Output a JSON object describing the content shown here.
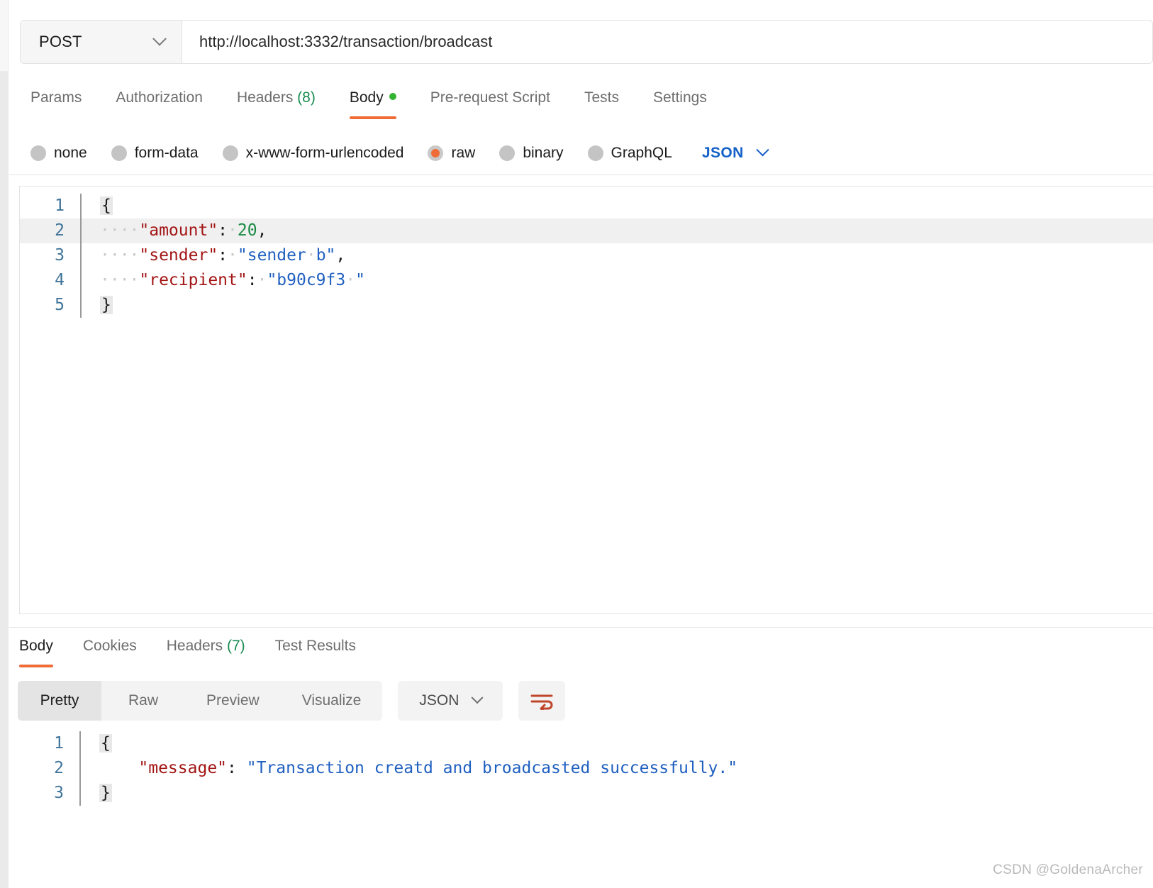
{
  "request": {
    "method": "POST",
    "method_caret": "chevron-down",
    "url": "http://localhost:3332/transaction/broadcast",
    "tabs": [
      {
        "label": "Params",
        "count": "",
        "active": false,
        "dot": false
      },
      {
        "label": "Authorization",
        "count": "",
        "active": false,
        "dot": false
      },
      {
        "label": "Headers",
        "count": "(8)",
        "active": false,
        "dot": false
      },
      {
        "label": "Body",
        "count": "",
        "active": true,
        "dot": true
      },
      {
        "label": "Pre-request Script",
        "count": "",
        "active": false,
        "dot": false
      },
      {
        "label": "Tests",
        "count": "",
        "active": false,
        "dot": false
      },
      {
        "label": "Settings",
        "count": "",
        "active": false,
        "dot": false
      }
    ],
    "body_types": [
      {
        "label": "none",
        "selected": false
      },
      {
        "label": "form-data",
        "selected": false
      },
      {
        "label": "x-www-form-urlencoded",
        "selected": false
      },
      {
        "label": "raw",
        "selected": true
      },
      {
        "label": "binary",
        "selected": false
      },
      {
        "label": "GraphQL",
        "selected": false
      }
    ],
    "raw_format": "JSON",
    "body_lines": [
      {
        "n": "1",
        "active": false,
        "tokens": [
          {
            "t": "brace",
            "v": "{"
          }
        ]
      },
      {
        "n": "2",
        "active": true,
        "tokens": [
          {
            "t": "ws",
            "v": "····"
          },
          {
            "t": "key",
            "v": "\"amount\""
          },
          {
            "t": "punct",
            "v": ":"
          },
          {
            "t": "ws",
            "v": "·"
          },
          {
            "t": "num",
            "v": "20"
          },
          {
            "t": "punct",
            "v": ","
          }
        ]
      },
      {
        "n": "3",
        "active": false,
        "tokens": [
          {
            "t": "ws",
            "v": "····"
          },
          {
            "t": "key",
            "v": "\"sender\""
          },
          {
            "t": "punct",
            "v": ":"
          },
          {
            "t": "ws",
            "v": "·"
          },
          {
            "t": "str",
            "v": "\"sender"
          },
          {
            "t": "ws",
            "v": "·"
          },
          {
            "t": "str",
            "v": "b\""
          },
          {
            "t": "punct",
            "v": ","
          }
        ]
      },
      {
        "n": "4",
        "active": false,
        "tokens": [
          {
            "t": "ws",
            "v": "····"
          },
          {
            "t": "key",
            "v": "\"recipient\""
          },
          {
            "t": "punct",
            "v": ":"
          },
          {
            "t": "ws",
            "v": "·"
          },
          {
            "t": "str",
            "v": "\"b90c9f3"
          },
          {
            "t": "ws",
            "v": "·"
          },
          {
            "t": "str",
            "v": "\""
          }
        ]
      },
      {
        "n": "5",
        "active": false,
        "tokens": [
          {
            "t": "brace",
            "v": "}"
          }
        ]
      }
    ]
  },
  "response": {
    "tabs": [
      {
        "label": "Body",
        "count": "",
        "active": true
      },
      {
        "label": "Cookies",
        "count": "",
        "active": false
      },
      {
        "label": "Headers",
        "count": "(7)",
        "active": false
      },
      {
        "label": "Test Results",
        "count": "",
        "active": false
      }
    ],
    "view_modes": [
      {
        "label": "Pretty",
        "active": true
      },
      {
        "label": "Raw",
        "active": false
      },
      {
        "label": "Preview",
        "active": false
      },
      {
        "label": "Visualize",
        "active": false
      }
    ],
    "format": "JSON",
    "wrap_icon": "wrap-text-icon",
    "body_lines": [
      {
        "n": "1",
        "active": false,
        "tokens": [
          {
            "t": "brace",
            "v": "{"
          }
        ]
      },
      {
        "n": "2",
        "active": false,
        "tokens": [
          {
            "t": "ws",
            "v": "    "
          },
          {
            "t": "key",
            "v": "\"message\""
          },
          {
            "t": "punct",
            "v": ": "
          },
          {
            "t": "str",
            "v": "\"Transaction creatd and broadcasted successfully.\""
          }
        ]
      },
      {
        "n": "3",
        "active": false,
        "tokens": [
          {
            "t": "brace",
            "v": "}"
          }
        ]
      }
    ]
  },
  "watermark": "CSDN @GoldenaArcher",
  "colors": {
    "accent": "#ef6c37",
    "link": "#1461c8",
    "green": "#178b4f",
    "key": "#a31515",
    "string": "#2060c0",
    "number": "#1a8a43",
    "linenum": "#3f7499"
  }
}
